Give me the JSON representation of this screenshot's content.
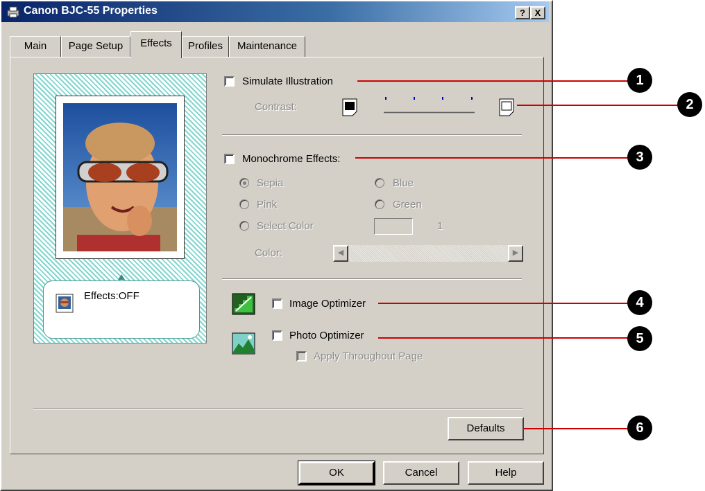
{
  "window": {
    "title": "Canon BJC-55 Properties",
    "help_btn": "?",
    "close_btn": "X"
  },
  "tabs": [
    {
      "label": "Main",
      "active": false
    },
    {
      "label": "Page Setup",
      "active": false
    },
    {
      "label": "Effects",
      "active": true
    },
    {
      "label": "Profiles",
      "active": false
    },
    {
      "label": "Maintenance",
      "active": false
    }
  ],
  "preview": {
    "status_label": "Effects:OFF"
  },
  "simulate": {
    "label": "Simulate Illustration",
    "checked": false,
    "contrast_label": "Contrast:"
  },
  "monochrome": {
    "label": "Monochrome Effects:",
    "checked": false,
    "options": {
      "sepia": "Sepia",
      "blue": "Blue",
      "pink": "Pink",
      "green": "Green",
      "select_color": "Select Color"
    },
    "selected": "Sepia",
    "color_value": "1",
    "color_label": "Color:"
  },
  "image_optimizer": {
    "label": "Image Optimizer",
    "checked": false
  },
  "photo_optimizer": {
    "label": "Photo Optimizer",
    "checked": false,
    "apply_label": "Apply Throughout Page"
  },
  "buttons": {
    "defaults": "Defaults",
    "ok": "OK",
    "cancel": "Cancel",
    "help": "Help"
  },
  "callouts": [
    "1",
    "2",
    "3",
    "4",
    "5",
    "6"
  ],
  "colors": {
    "callout_line": "#cc0000",
    "title_bar": "#0a246a",
    "preview_hatch": "#7fd6cf"
  }
}
